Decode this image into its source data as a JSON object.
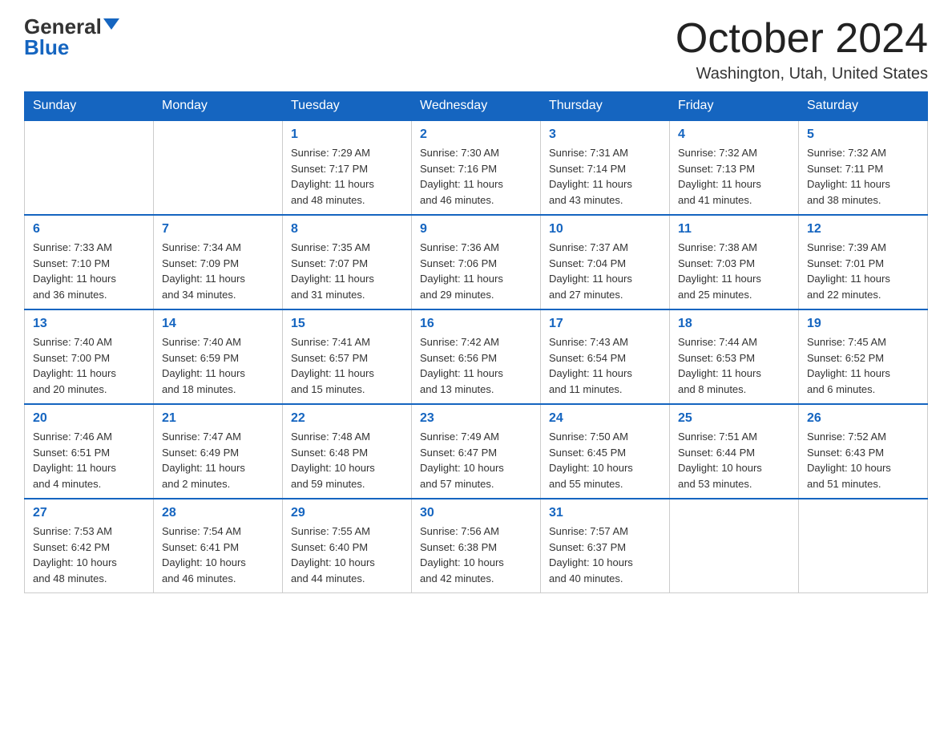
{
  "header": {
    "logo_general": "General",
    "logo_blue": "Blue",
    "title": "October 2024",
    "location": "Washington, Utah, United States"
  },
  "days_of_week": [
    "Sunday",
    "Monday",
    "Tuesday",
    "Wednesday",
    "Thursday",
    "Friday",
    "Saturday"
  ],
  "weeks": [
    [
      {
        "day": "",
        "info": ""
      },
      {
        "day": "",
        "info": ""
      },
      {
        "day": "1",
        "info": "Sunrise: 7:29 AM\nSunset: 7:17 PM\nDaylight: 11 hours\nand 48 minutes."
      },
      {
        "day": "2",
        "info": "Sunrise: 7:30 AM\nSunset: 7:16 PM\nDaylight: 11 hours\nand 46 minutes."
      },
      {
        "day": "3",
        "info": "Sunrise: 7:31 AM\nSunset: 7:14 PM\nDaylight: 11 hours\nand 43 minutes."
      },
      {
        "day": "4",
        "info": "Sunrise: 7:32 AM\nSunset: 7:13 PM\nDaylight: 11 hours\nand 41 minutes."
      },
      {
        "day": "5",
        "info": "Sunrise: 7:32 AM\nSunset: 7:11 PM\nDaylight: 11 hours\nand 38 minutes."
      }
    ],
    [
      {
        "day": "6",
        "info": "Sunrise: 7:33 AM\nSunset: 7:10 PM\nDaylight: 11 hours\nand 36 minutes."
      },
      {
        "day": "7",
        "info": "Sunrise: 7:34 AM\nSunset: 7:09 PM\nDaylight: 11 hours\nand 34 minutes."
      },
      {
        "day": "8",
        "info": "Sunrise: 7:35 AM\nSunset: 7:07 PM\nDaylight: 11 hours\nand 31 minutes."
      },
      {
        "day": "9",
        "info": "Sunrise: 7:36 AM\nSunset: 7:06 PM\nDaylight: 11 hours\nand 29 minutes."
      },
      {
        "day": "10",
        "info": "Sunrise: 7:37 AM\nSunset: 7:04 PM\nDaylight: 11 hours\nand 27 minutes."
      },
      {
        "day": "11",
        "info": "Sunrise: 7:38 AM\nSunset: 7:03 PM\nDaylight: 11 hours\nand 25 minutes."
      },
      {
        "day": "12",
        "info": "Sunrise: 7:39 AM\nSunset: 7:01 PM\nDaylight: 11 hours\nand 22 minutes."
      }
    ],
    [
      {
        "day": "13",
        "info": "Sunrise: 7:40 AM\nSunset: 7:00 PM\nDaylight: 11 hours\nand 20 minutes."
      },
      {
        "day": "14",
        "info": "Sunrise: 7:40 AM\nSunset: 6:59 PM\nDaylight: 11 hours\nand 18 minutes."
      },
      {
        "day": "15",
        "info": "Sunrise: 7:41 AM\nSunset: 6:57 PM\nDaylight: 11 hours\nand 15 minutes."
      },
      {
        "day": "16",
        "info": "Sunrise: 7:42 AM\nSunset: 6:56 PM\nDaylight: 11 hours\nand 13 minutes."
      },
      {
        "day": "17",
        "info": "Sunrise: 7:43 AM\nSunset: 6:54 PM\nDaylight: 11 hours\nand 11 minutes."
      },
      {
        "day": "18",
        "info": "Sunrise: 7:44 AM\nSunset: 6:53 PM\nDaylight: 11 hours\nand 8 minutes."
      },
      {
        "day": "19",
        "info": "Sunrise: 7:45 AM\nSunset: 6:52 PM\nDaylight: 11 hours\nand 6 minutes."
      }
    ],
    [
      {
        "day": "20",
        "info": "Sunrise: 7:46 AM\nSunset: 6:51 PM\nDaylight: 11 hours\nand 4 minutes."
      },
      {
        "day": "21",
        "info": "Sunrise: 7:47 AM\nSunset: 6:49 PM\nDaylight: 11 hours\nand 2 minutes."
      },
      {
        "day": "22",
        "info": "Sunrise: 7:48 AM\nSunset: 6:48 PM\nDaylight: 10 hours\nand 59 minutes."
      },
      {
        "day": "23",
        "info": "Sunrise: 7:49 AM\nSunset: 6:47 PM\nDaylight: 10 hours\nand 57 minutes."
      },
      {
        "day": "24",
        "info": "Sunrise: 7:50 AM\nSunset: 6:45 PM\nDaylight: 10 hours\nand 55 minutes."
      },
      {
        "day": "25",
        "info": "Sunrise: 7:51 AM\nSunset: 6:44 PM\nDaylight: 10 hours\nand 53 minutes."
      },
      {
        "day": "26",
        "info": "Sunrise: 7:52 AM\nSunset: 6:43 PM\nDaylight: 10 hours\nand 51 minutes."
      }
    ],
    [
      {
        "day": "27",
        "info": "Sunrise: 7:53 AM\nSunset: 6:42 PM\nDaylight: 10 hours\nand 48 minutes."
      },
      {
        "day": "28",
        "info": "Sunrise: 7:54 AM\nSunset: 6:41 PM\nDaylight: 10 hours\nand 46 minutes."
      },
      {
        "day": "29",
        "info": "Sunrise: 7:55 AM\nSunset: 6:40 PM\nDaylight: 10 hours\nand 44 minutes."
      },
      {
        "day": "30",
        "info": "Sunrise: 7:56 AM\nSunset: 6:38 PM\nDaylight: 10 hours\nand 42 minutes."
      },
      {
        "day": "31",
        "info": "Sunrise: 7:57 AM\nSunset: 6:37 PM\nDaylight: 10 hours\nand 40 minutes."
      },
      {
        "day": "",
        "info": ""
      },
      {
        "day": "",
        "info": ""
      }
    ]
  ]
}
